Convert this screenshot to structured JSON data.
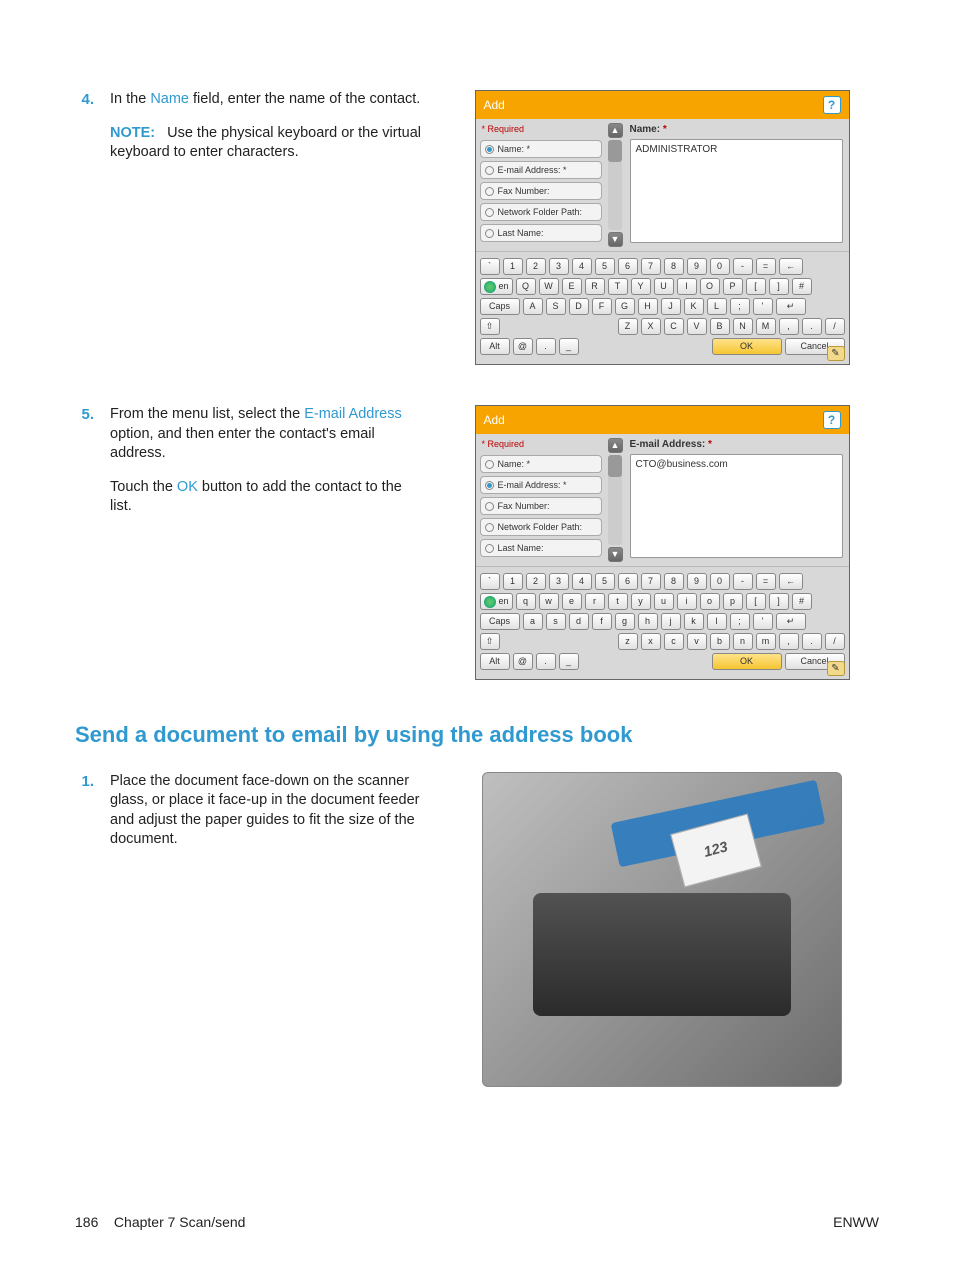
{
  "steps": {
    "s4": {
      "num": "4.",
      "text_a": "In the ",
      "text_link1": "Name",
      "text_b": " field, enter the name of the contact.",
      "note_label": "NOTE:",
      "note_text": "Use the physical keyboard or the virtual keyboard to enter characters."
    },
    "s5": {
      "num": "5.",
      "text_a": "From the menu list, select the ",
      "text_link1": "E-mail Address",
      "text_b": " option, and then enter the contact's email address.",
      "text2_a": "Touch the ",
      "text2_link": "OK",
      "text2_b": " button to add the contact to the list."
    },
    "s1": {
      "num": "1.",
      "text": "Place the document face-down on the scanner glass, or place it face-up in the document feeder and adjust the paper guides to fit the size of the document."
    }
  },
  "section_heading": "Send a document to email by using the address book",
  "panel": {
    "title": "Add",
    "required": "* Required",
    "options": {
      "name": "Name: *",
      "email": "E-mail Address: *",
      "fax": "Fax Number:",
      "folder": "Network Folder Path:",
      "lastname": "Last Name:"
    },
    "field1": {
      "label": "Name: ",
      "star": "*",
      "value": "ADMINISTRATOR"
    },
    "field2": {
      "label": "E-mail Address: ",
      "star": "*",
      "value": "CTO@business.com"
    }
  },
  "keyboard": {
    "r1": [
      "`",
      "1",
      "2",
      "3",
      "4",
      "5",
      "6",
      "7",
      "8",
      "9",
      "0",
      "-",
      "=",
      "←"
    ],
    "r2u": [
      "en",
      "Q",
      "W",
      "E",
      "R",
      "T",
      "Y",
      "U",
      "I",
      "O",
      "P",
      "[",
      "]",
      "#"
    ],
    "r2l": [
      "en",
      "q",
      "w",
      "e",
      "r",
      "t",
      "y",
      "u",
      "i",
      "o",
      "p",
      "[",
      "]",
      "#"
    ],
    "r3u": [
      "Caps",
      "A",
      "S",
      "D",
      "F",
      "G",
      "H",
      "J",
      "K",
      "L",
      ";",
      "'",
      "↵"
    ],
    "r3l": [
      "Caps",
      "a",
      "s",
      "d",
      "f",
      "g",
      "h",
      "j",
      "k",
      "l",
      ";",
      "'",
      "↵"
    ],
    "r4u": [
      "⇧",
      "Z",
      "X",
      "C",
      "V",
      "B",
      "N",
      "M",
      ",",
      ".",
      "/"
    ],
    "r4l": [
      "⇧",
      "z",
      "x",
      "c",
      "v",
      "b",
      "n",
      "m",
      ",",
      ".",
      "/"
    ],
    "r5": [
      "Alt",
      "@",
      ".",
      "_"
    ],
    "ok": "OK",
    "cancel": "Cancel"
  },
  "doc_sheet": "123",
  "footer": {
    "page": "186",
    "chapter": "Chapter 7   Scan/send",
    "lang": "ENWW"
  }
}
